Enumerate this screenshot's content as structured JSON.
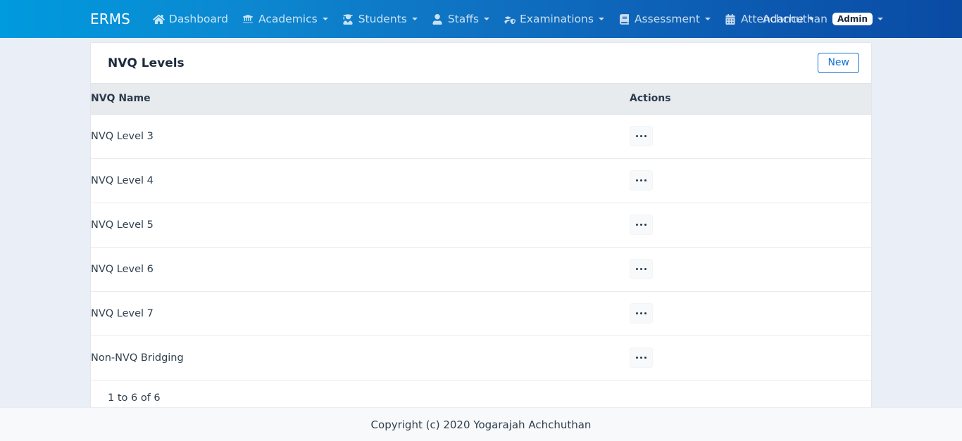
{
  "navbar": {
    "brand": "ERMS",
    "items": [
      {
        "label": "Dashboard",
        "icon": "home-icon",
        "caret": false
      },
      {
        "label": "Academics",
        "icon": "bank-icon",
        "caret": true
      },
      {
        "label": "Students",
        "icon": "user-graduate-icon",
        "caret": true
      },
      {
        "label": "Staffs",
        "icon": "user-tie-icon",
        "caret": true
      },
      {
        "label": "Examinations",
        "icon": "graduation-cap-icon",
        "caret": true
      },
      {
        "label": "Assessment",
        "icon": "book-icon",
        "caret": true
      },
      {
        "label": "Attendance",
        "icon": "calendar-icon",
        "caret": true
      }
    ],
    "user": {
      "name": "Achchuthan",
      "role_badge": "Admin"
    },
    "colors": {
      "gradient_start": "#009ade",
      "gradient_end": "#0a4ba4"
    }
  },
  "card": {
    "title": "NVQ Levels",
    "new_button": "New"
  },
  "table": {
    "columns": [
      "NVQ Name",
      "Actions"
    ],
    "rows": [
      {
        "name": "NVQ Level 3",
        "action": "row-actions-menu"
      },
      {
        "name": "NVQ Level 4",
        "action": "row-actions-menu"
      },
      {
        "name": "NVQ Level 5",
        "action": "row-actions-menu"
      },
      {
        "name": "NVQ Level 6",
        "action": "row-actions-menu"
      },
      {
        "name": "NVQ Level 7",
        "action": "row-actions-menu"
      },
      {
        "name": "Non-NVQ Bridging",
        "action": "row-actions-menu"
      }
    ],
    "summary": "1 to 6 of 6"
  },
  "footer": {
    "copyright": "Copyright (c) 2020 Yogarajah Achchuthan"
  }
}
